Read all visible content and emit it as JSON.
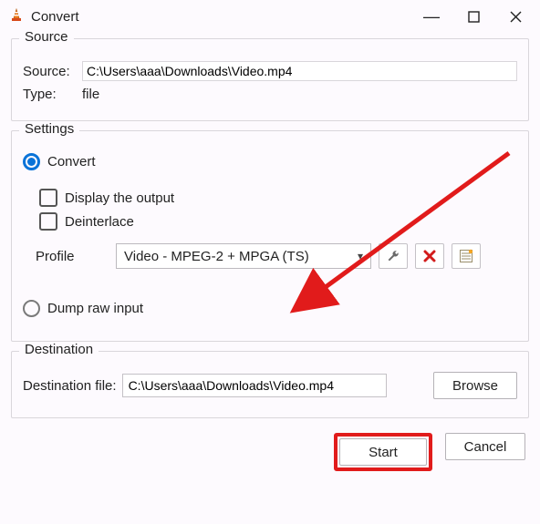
{
  "window": {
    "title": "Convert",
    "minimize": "—",
    "maximize": "▢",
    "close": "✕"
  },
  "source": {
    "group_label": "Source",
    "source_label": "Source:",
    "source_value": "C:\\Users\\aaa\\Downloads\\Video.mp4",
    "type_label": "Type:",
    "type_value": "file"
  },
  "settings": {
    "group_label": "Settings",
    "convert_label": "Convert",
    "display_output_label": "Display the output",
    "deinterlace_label": "Deinterlace",
    "profile_label": "Profile",
    "profile_value": "Video - MPEG-2 + MPGA (TS)",
    "dump_raw_label": "Dump raw input",
    "icons": {
      "tools": "wrench-icon",
      "delete": "x-icon",
      "new": "list-icon"
    }
  },
  "destination": {
    "group_label": "Destination",
    "dest_label": "Destination file:",
    "dest_value": "C:\\Users\\aaa\\Downloads\\Video.mp4",
    "browse_label": "Browse"
  },
  "footer": {
    "start_label": "Start",
    "cancel_label": "Cancel"
  },
  "annotation": {
    "highlight_target": "start-button",
    "arrow_target": "profile-select"
  }
}
